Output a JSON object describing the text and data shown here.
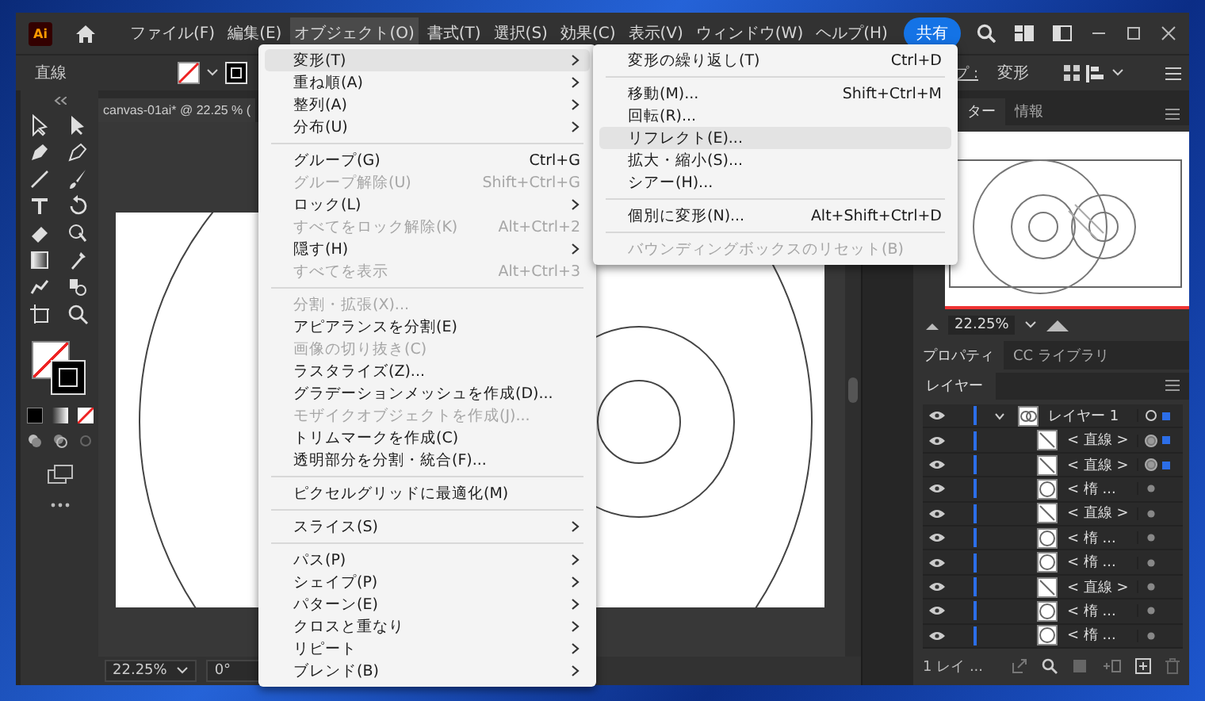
{
  "app": {
    "logo": "Ai"
  },
  "menu_bar": [
    {
      "label": "ファイル(F)",
      "selected": false
    },
    {
      "label": "編集(E)",
      "selected": false
    },
    {
      "label": "オブジェクト(O)",
      "selected": true
    },
    {
      "label": "書式(T)",
      "selected": false
    },
    {
      "label": "選択(S)",
      "selected": false
    },
    {
      "label": "効果(C)",
      "selected": false
    },
    {
      "label": "表示(V)",
      "selected": false
    },
    {
      "label": "ウィンドウ(W)",
      "selected": false
    },
    {
      "label": "ヘルプ(H)",
      "selected": false
    }
  ],
  "share_button": "共有",
  "control_bar": {
    "selection": "直線",
    "shape_link": "プ :",
    "transform": "変形"
  },
  "document_tab": "canvas-01ai* @ 22.25 % (",
  "status_bar": {
    "zoom": "22.25%",
    "rotation": "0°"
  },
  "object_menu": [
    {
      "kind": "item",
      "label": "変形(T)",
      "submenu": true,
      "disabled": false,
      "selected": true
    },
    {
      "kind": "item",
      "label": "重ね順(A)",
      "submenu": true,
      "disabled": false,
      "selected": false
    },
    {
      "kind": "item",
      "label": "整列(A)",
      "submenu": true,
      "disabled": false,
      "selected": false
    },
    {
      "kind": "item",
      "label": "分布(U)",
      "submenu": true,
      "disabled": false,
      "selected": false
    },
    {
      "kind": "separator"
    },
    {
      "kind": "item",
      "label": "グループ(G)",
      "shortcut": "Ctrl+G",
      "submenu": false,
      "disabled": false,
      "selected": false
    },
    {
      "kind": "item",
      "label": "グループ解除(U)",
      "shortcut": "Shift+Ctrl+G",
      "submenu": false,
      "disabled": true,
      "selected": false
    },
    {
      "kind": "item",
      "label": "ロック(L)",
      "submenu": true,
      "disabled": false,
      "selected": false
    },
    {
      "kind": "item",
      "label": "すべてをロック解除(K)",
      "shortcut": "Alt+Ctrl+2",
      "submenu": false,
      "disabled": true,
      "selected": false
    },
    {
      "kind": "item",
      "label": "隠す(H)",
      "submenu": true,
      "disabled": false,
      "selected": false
    },
    {
      "kind": "item",
      "label": "すべてを表示",
      "shortcut": "Alt+Ctrl+3",
      "submenu": false,
      "disabled": true,
      "selected": false
    },
    {
      "kind": "separator"
    },
    {
      "kind": "item",
      "label": "分割・拡張(X)...",
      "submenu": false,
      "disabled": true,
      "selected": false
    },
    {
      "kind": "item",
      "label": "アピアランスを分割(E)",
      "submenu": false,
      "disabled": false,
      "selected": false
    },
    {
      "kind": "item",
      "label": "画像の切り抜き(C)",
      "submenu": false,
      "disabled": true,
      "selected": false
    },
    {
      "kind": "item",
      "label": "ラスタライズ(Z)...",
      "submenu": false,
      "disabled": false,
      "selected": false
    },
    {
      "kind": "item",
      "label": "グラデーションメッシュを作成(D)...",
      "submenu": false,
      "disabled": false,
      "selected": false
    },
    {
      "kind": "item",
      "label": "モザイクオブジェクトを作成(J)...",
      "submenu": false,
      "disabled": true,
      "selected": false
    },
    {
      "kind": "item",
      "label": "トリムマークを作成(C)",
      "submenu": false,
      "disabled": false,
      "selected": false
    },
    {
      "kind": "item",
      "label": "透明部分を分割・統合(F)...",
      "submenu": false,
      "disabled": false,
      "selected": false
    },
    {
      "kind": "separator"
    },
    {
      "kind": "item",
      "label": "ピクセルグリッドに最適化(M)",
      "submenu": false,
      "disabled": false,
      "selected": false
    },
    {
      "kind": "separator"
    },
    {
      "kind": "item",
      "label": "スライス(S)",
      "submenu": true,
      "disabled": false,
      "selected": false
    },
    {
      "kind": "separator"
    },
    {
      "kind": "item",
      "label": "パス(P)",
      "submenu": true,
      "disabled": false,
      "selected": false
    },
    {
      "kind": "item",
      "label": "シェイプ(P)",
      "submenu": true,
      "disabled": false,
      "selected": false
    },
    {
      "kind": "item",
      "label": "パターン(E)",
      "submenu": true,
      "disabled": false,
      "selected": false
    },
    {
      "kind": "item",
      "label": "クロスと重なり",
      "submenu": true,
      "disabled": false,
      "selected": false
    },
    {
      "kind": "item",
      "label": "リピート",
      "submenu": true,
      "disabled": false,
      "selected": false
    },
    {
      "kind": "item",
      "label": "ブレンド(B)",
      "submenu": true,
      "disabled": false,
      "selected": false
    }
  ],
  "transform_submenu": [
    {
      "kind": "item",
      "label": "変形の繰り返し(T)",
      "shortcut": "Ctrl+D",
      "disabled": false,
      "selected": false
    },
    {
      "kind": "separator"
    },
    {
      "kind": "item",
      "label": "移動(M)...",
      "shortcut": "Shift+Ctrl+M",
      "disabled": false,
      "selected": false
    },
    {
      "kind": "item",
      "label": "回転(R)...",
      "disabled": false,
      "selected": false
    },
    {
      "kind": "item",
      "label": "リフレクト(E)...",
      "disabled": false,
      "selected": true
    },
    {
      "kind": "item",
      "label": "拡大・縮小(S)...",
      "disabled": false,
      "selected": false
    },
    {
      "kind": "item",
      "label": "シアー(H)...",
      "disabled": false,
      "selected": false
    },
    {
      "kind": "separator"
    },
    {
      "kind": "item",
      "label": "個別に変形(N)...",
      "shortcut": "Alt+Shift+Ctrl+D",
      "disabled": false,
      "selected": false
    },
    {
      "kind": "separator"
    },
    {
      "kind": "item",
      "label": "バウンディングボックスのリセット(B)",
      "disabled": true,
      "selected": false
    }
  ],
  "panels": {
    "top_tabs": [
      {
        "label": "ター",
        "selected": true
      },
      {
        "label": "情報",
        "selected": false
      }
    ],
    "navigator_zoom": "22.25%",
    "mid_tabs": [
      {
        "label": "プロパティ",
        "selected": true
      },
      {
        "label": "CC ライブラリ",
        "selected": false
      }
    ],
    "layers_tab": "レイヤー",
    "layers": [
      {
        "name": "レイヤー 1",
        "expanded": true,
        "selected": true,
        "children": [
          {
            "name": "< 直線 >",
            "kind": "line",
            "selected": true
          },
          {
            "name": "< 直線 >",
            "kind": "line",
            "selected": true
          },
          {
            "name": "< 楕 ...",
            "kind": "ellipse",
            "selected": false
          },
          {
            "name": "< 直線 >",
            "kind": "line",
            "selected": false
          },
          {
            "name": "< 楕 ...",
            "kind": "ellipse",
            "selected": false
          },
          {
            "name": "< 楕 ...",
            "kind": "ellipse",
            "selected": false
          },
          {
            "name": "< 直線 >",
            "kind": "line",
            "selected": false
          },
          {
            "name": "< 楕 ...",
            "kind": "ellipse",
            "selected": false
          },
          {
            "name": "< 楕 ...",
            "kind": "ellipse",
            "selected": false
          }
        ]
      }
    ],
    "layers_count": "1 レイ ..."
  }
}
